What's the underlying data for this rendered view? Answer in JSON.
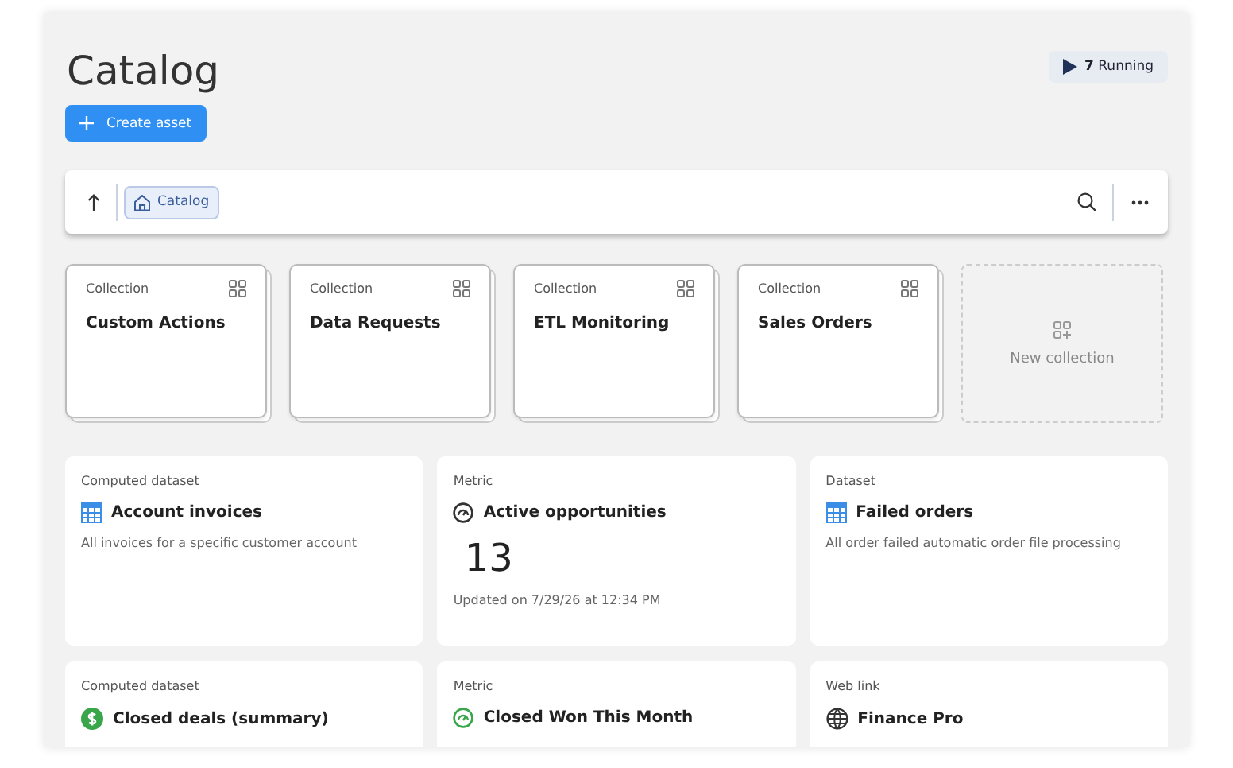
{
  "title": "Catalog",
  "running": "**7** Running",
  "create_button": "Create asset",
  "toolbar": {
    "breadcrumb": "Catalog"
  },
  "collections": [
    {
      "type": "Collection",
      "name": "Custom Actions"
    },
    {
      "type": "Collection",
      "name": "Data Requests"
    },
    {
      "type": "Collection",
      "name": "ETL Monitoring"
    },
    {
      "type": "Collection",
      "name": "Sales Orders"
    }
  ],
  "new_collection": "New collection",
  "assets": [
    {
      "kind": "table",
      "color": "#3a8ee6",
      "type": "Computed dataset",
      "name": "Account invoices",
      "description": "All invoices for a specific customer account"
    },
    {
      "kind": "gauge",
      "color": "#333333",
      "type": "Metric",
      "name": "Active opportunities",
      "value": "13",
      "updated": "Updated on 7/29/26 at 12:34 PM"
    },
    {
      "kind": "table",
      "color": "#3a8ee6",
      "type": "Dataset",
      "name": "Failed orders",
      "description": "All order failed automatic order file processing"
    },
    {
      "kind": "money",
      "color": "#3aa64a",
      "type": "Computed dataset",
      "name": "Closed deals (summary)"
    },
    {
      "kind": "gauge",
      "color": "#3aa64a",
      "type": "Metric",
      "name": "Closed Won This Month"
    },
    {
      "kind": "globe",
      "color": "#333333",
      "type": "Web link",
      "name": "Finance Pro"
    }
  ]
}
